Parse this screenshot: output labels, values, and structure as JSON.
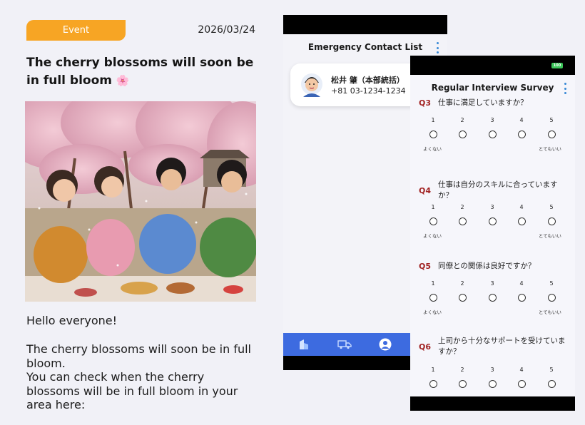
{
  "article": {
    "badge": "Event",
    "date": "2026/03/24",
    "title": "The cherry blossoms will soon be in full bloom",
    "title_emoji": "🌸",
    "greeting": "Hello everyone!",
    "paragraphs": [
      "The cherry blossoms will soon be in full bloom.",
      "You can check when the cherry blossoms will be in full bloom in your area here:"
    ],
    "photo_icon": "cherry-blossom-picnic-photo"
  },
  "contacts": {
    "title": "Emergency Contact List",
    "menu_icon": "kebab-menu-icon",
    "items": [
      {
        "name": "松井 肇（本部統括）",
        "phone": "+81 03-1234-1234",
        "avatar_icon": "man-avatar-icon"
      }
    ],
    "nav": [
      {
        "icon": "building-icon",
        "label": ""
      },
      {
        "icon": "truck-icon",
        "label": ""
      },
      {
        "icon": "person-icon",
        "label": ""
      }
    ],
    "nav_color": "#3d6be0"
  },
  "survey": {
    "title": "Regular Interview Survey",
    "battery": "100",
    "menu_icon": "kebab-menu-icon",
    "scale_labels": [
      "1",
      "2",
      "3",
      "4",
      "5"
    ],
    "low_label": "よくない",
    "high_label": "とてもいい",
    "questions": [
      {
        "num": "Q3",
        "text": "仕事に満足していますか？"
      },
      {
        "num": "Q4",
        "text": "仕事は自分のスキルに合っていますか？"
      },
      {
        "num": "Q5",
        "text": "同僚との関係は良好ですか？"
      },
      {
        "num": "Q6",
        "text": "上司から十分なサポートを受けていますか？"
      }
    ],
    "accent_color": "#a22323"
  },
  "colors": {
    "badge": "#f7a524",
    "background": "#f1f1f7"
  }
}
